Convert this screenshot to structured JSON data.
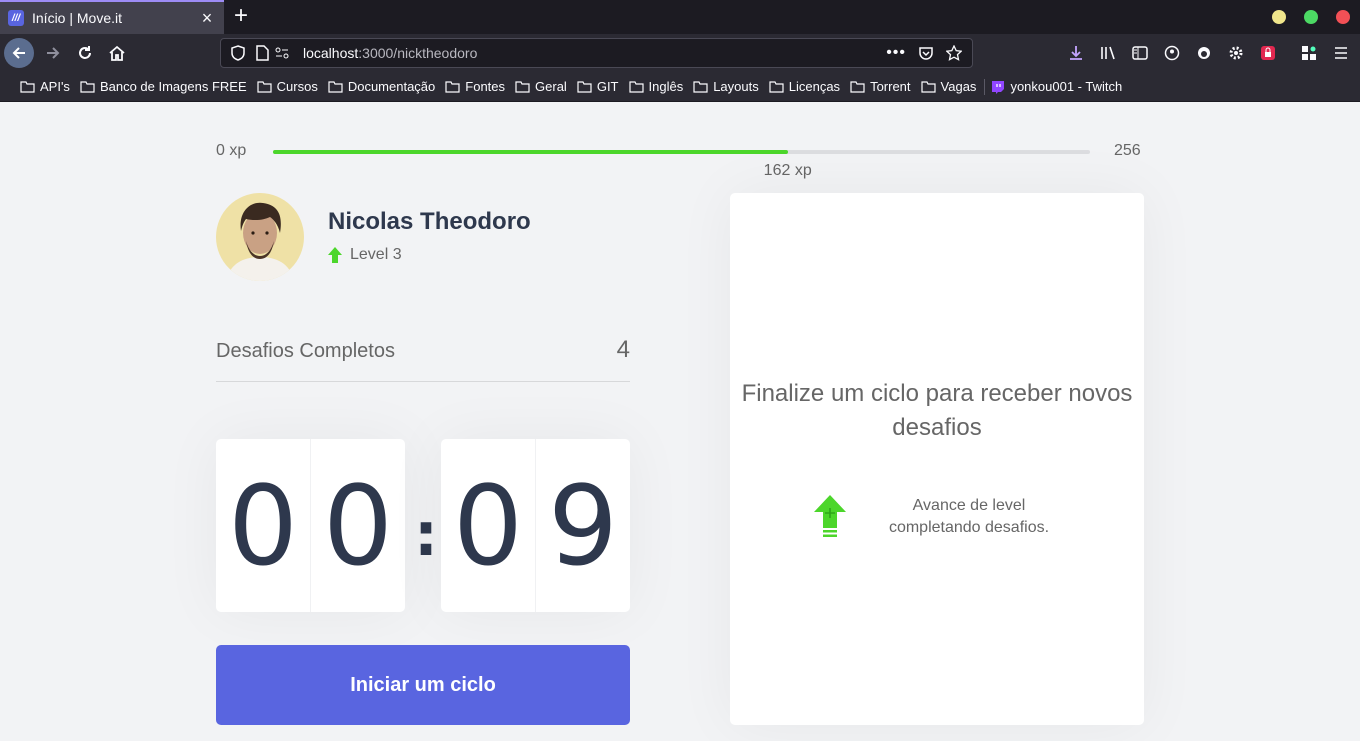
{
  "browser": {
    "tab_title": "Início | Move.it",
    "tab_favicon": "///",
    "url_host": "localhost",
    "url_rest": ":3000/nicktheodoro",
    "bookmarks": [
      {
        "label": "API's",
        "icon": "folder-icon"
      },
      {
        "label": "Banco de Imagens FREE",
        "icon": "folder-icon"
      },
      {
        "label": "Cursos",
        "icon": "folder-icon"
      },
      {
        "label": "Documentação",
        "icon": "folder-icon"
      },
      {
        "label": "Fontes",
        "icon": "folder-icon"
      },
      {
        "label": "Geral",
        "icon": "folder-icon"
      },
      {
        "label": "GIT",
        "icon": "folder-icon"
      },
      {
        "label": "Inglês",
        "icon": "folder-icon"
      },
      {
        "label": "Layouts",
        "icon": "folder-icon"
      },
      {
        "label": "Licenças",
        "icon": "folder-icon"
      },
      {
        "label": "Torrent",
        "icon": "folder-icon"
      },
      {
        "label": "Vagas",
        "icon": "folder-icon"
      },
      {
        "label": "yonkou001 - Twitch",
        "icon": "twitch-icon"
      }
    ]
  },
  "experience": {
    "start_label": "0 xp",
    "end_label": "256",
    "current_label": "162 xp",
    "current": 162,
    "max": 256,
    "progress_fraction": 0.63
  },
  "profile": {
    "name": "Nicolas Theodoro",
    "level_label": "Level 3"
  },
  "completed": {
    "label": "Desafios Completos",
    "value": "4"
  },
  "countdown": {
    "minute_left": "0",
    "minute_right": "0",
    "separator": ":",
    "second_left": "0",
    "second_right": "9"
  },
  "start_button_label": "Iniciar um ciclo",
  "challenge_box": {
    "title": "Finalize um ciclo para receber novos desafios",
    "hint": "Avance de level completando desafios."
  },
  "colors": {
    "accent": "#5965e0",
    "green": "#4cd62b",
    "text": "#666666",
    "title": "#2e384d",
    "background": "#f2f3f5"
  }
}
